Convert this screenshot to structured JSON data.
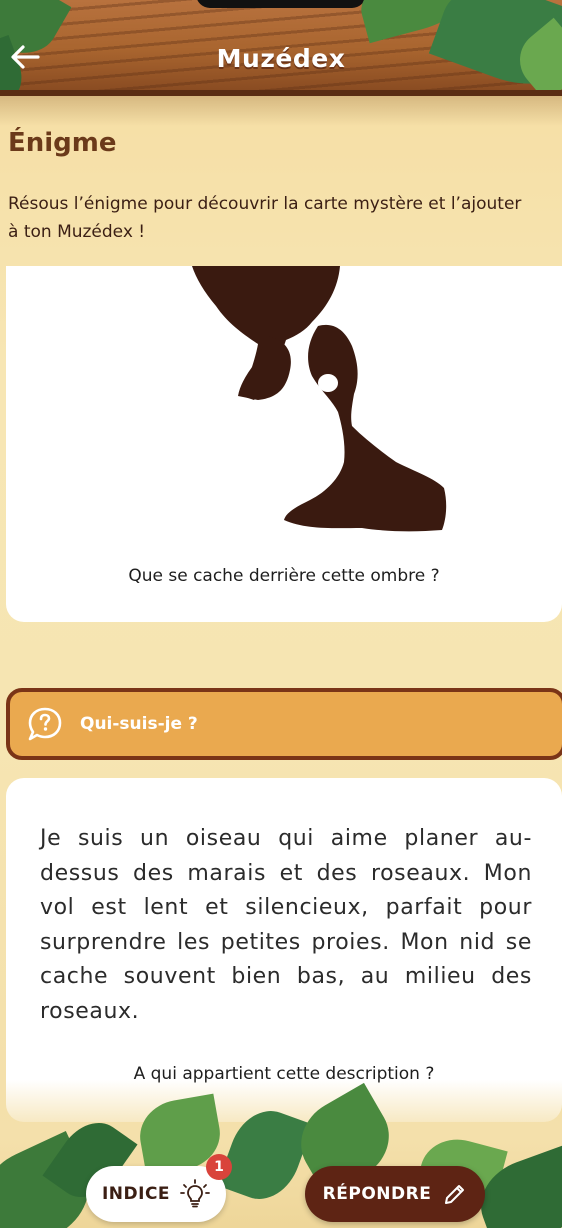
{
  "header": {
    "title": "Muzédex",
    "back_icon": "arrow-left-icon"
  },
  "section": {
    "title": "Énigme",
    "intro_line1": "Résous l’énigme pour découvrir la carte mystère et l’ajouter",
    "intro_line2": "à ton Muzédex !"
  },
  "shadow_card": {
    "image": "bird-silhouette",
    "question": "Que se cache derrière cette ombre ?"
  },
  "riddle_banner": {
    "icon": "question-bubble-icon",
    "label": "Qui-suis-je ?"
  },
  "description_card": {
    "text": "Je suis un oiseau qui aime planer au-dessus des marais et des roseaux. Mon vol est lent et silencieux, parfait pour surprendre les petites proies. Mon nid se cache souvent bien bas, au milieu des roseaux.",
    "question": "A qui appartient cette description ?"
  },
  "actions": {
    "hint_label": "INDICE",
    "hint_icon": "lightbulb-icon",
    "hint_badge": "1",
    "answer_label": "RÉPONDRE",
    "answer_icon": "pencil-icon"
  },
  "colors": {
    "wood": "#a9652f",
    "banner": "#eaa94f",
    "banner_border": "#7a3417",
    "answer_button": "#5e2414",
    "badge": "#d9433b",
    "silhouette": "#3a1a10"
  }
}
